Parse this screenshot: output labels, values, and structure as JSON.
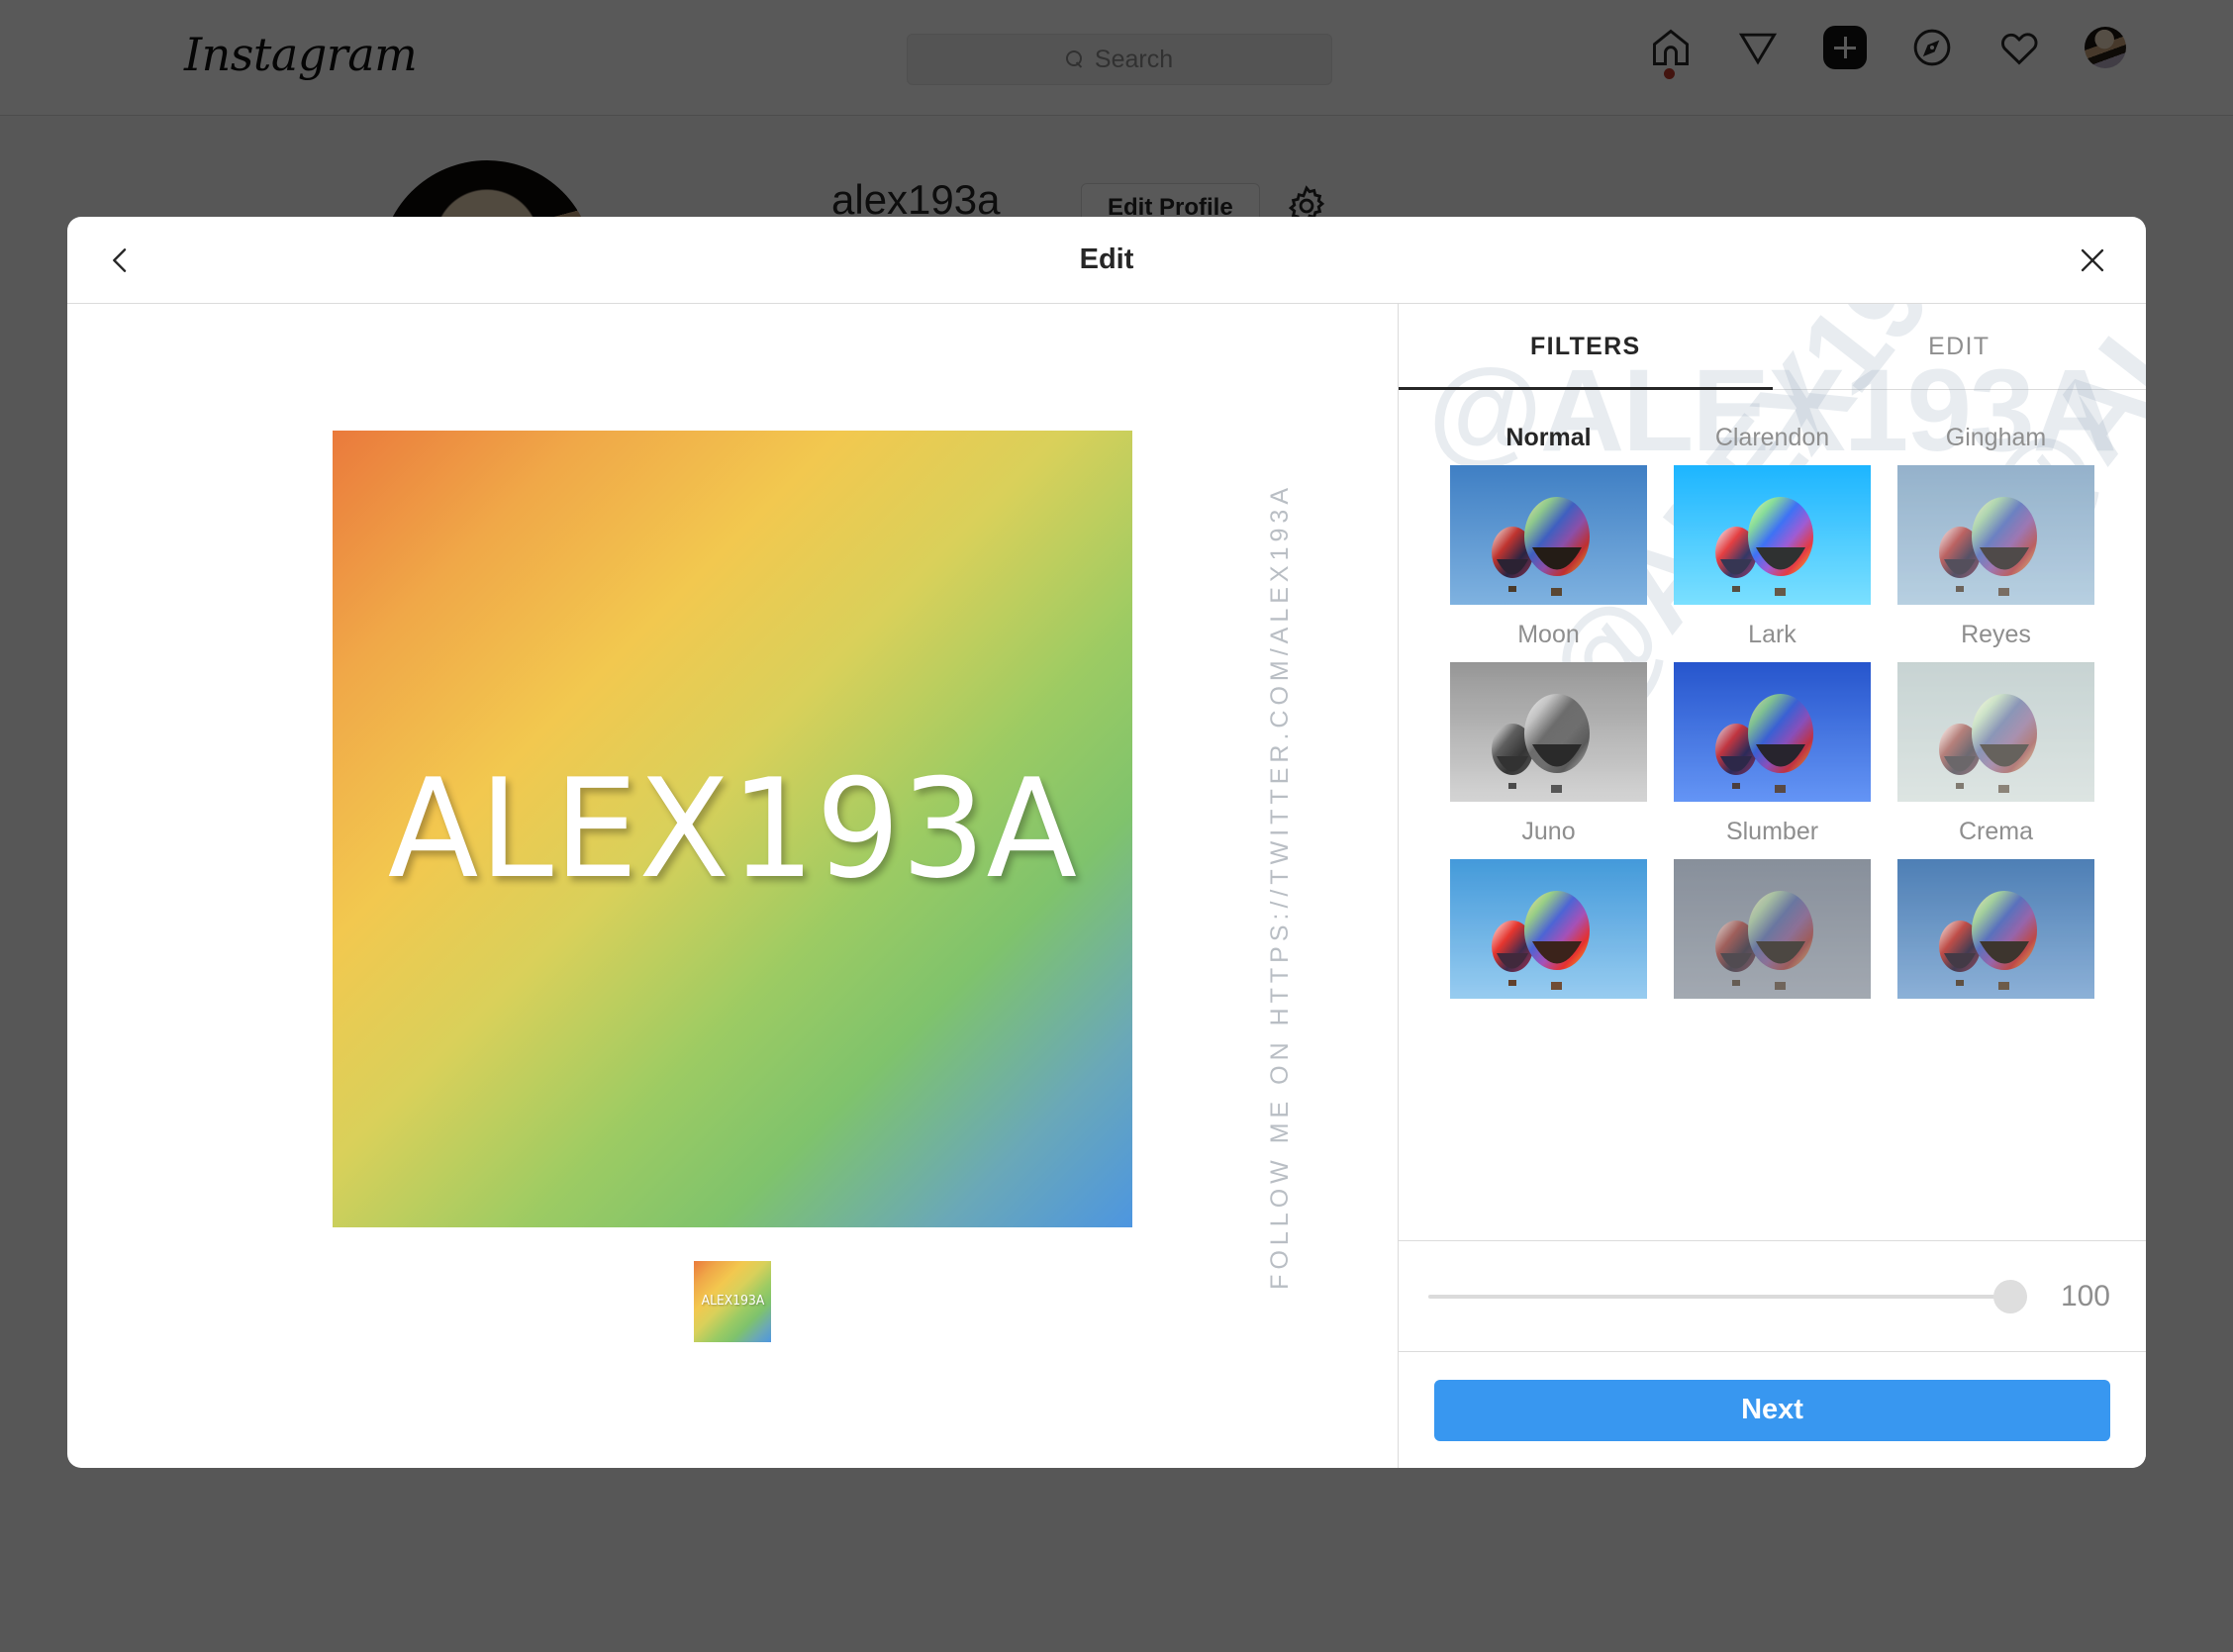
{
  "background": {
    "brand": "Instagram",
    "search": {
      "placeholder": "Search",
      "icon": "search-icon"
    },
    "nav_icons": [
      "home-icon",
      "direct-message-icon",
      "new-post-icon",
      "explore-icon",
      "activity-heart-icon",
      "profile-avatar"
    ],
    "profile": {
      "username": "alex193a",
      "edit_profile_label": "Edit Profile",
      "settings_icon": "gear-icon"
    }
  },
  "modal": {
    "title": "Edit",
    "back_icon": "chevron-left-icon",
    "close_icon": "close-icon",
    "preview": {
      "text": "ALEX193A",
      "thumbnail_text": "ALEX193A"
    },
    "watermark_vertical": "FOLLOW ME ON HTTPS://TWITTER.COM/ALEX193A",
    "watermark_diagonal": "@ALEX193A",
    "tabs": [
      {
        "label": "FILTERS",
        "active": true
      },
      {
        "label": "EDIT",
        "active": false
      }
    ],
    "filters": [
      {
        "label": "Normal",
        "selected": true,
        "sky_top": "#3f7fc4",
        "sky_bottom": "#7fb2e0",
        "sat": 1.0,
        "bright": 1.0,
        "gray": 0.0,
        "tint": "rgba(0,0,0,0)"
      },
      {
        "label": "Clarendon",
        "selected": false,
        "sky_top": "#2f9fe8",
        "sky_bottom": "#86cdf5",
        "sat": 1.3,
        "bright": 1.08,
        "gray": 0.0,
        "tint": "rgba(120,200,255,0.10)"
      },
      {
        "label": "Gingham",
        "selected": false,
        "sky_top": "#6f9cc0",
        "sky_bottom": "#9cc0d8",
        "sat": 0.82,
        "bright": 1.05,
        "gray": 0.05,
        "tint": "rgba(220,225,235,0.22)"
      },
      {
        "label": "Moon",
        "selected": false,
        "sky_top": "#8a8a8a",
        "sky_bottom": "#c8c8c8",
        "sat": 0.0,
        "bright": 1.05,
        "gray": 1.0,
        "tint": "rgba(255,255,255,0.05)"
      },
      {
        "label": "Lark",
        "selected": false,
        "sky_top": "#2a53b8",
        "sky_bottom": "#6f9ae8",
        "sat": 1.15,
        "bright": 1.02,
        "gray": 0.0,
        "tint": "rgba(60,90,200,0.12)"
      },
      {
        "label": "Reyes",
        "selected": false,
        "sky_top": "#8fb1b8",
        "sky_bottom": "#afc6c8",
        "sat": 0.6,
        "bright": 1.12,
        "gray": 0.2,
        "tint": "rgba(230,225,205,0.30)"
      },
      {
        "label": "Juno",
        "selected": false,
        "sky_top": "#3d93cc",
        "sky_bottom": "#8fc8e8",
        "sat": 1.2,
        "bright": 1.05,
        "gray": 0.0,
        "tint": "rgba(255,120,100,0.08)"
      },
      {
        "label": "Slumber",
        "selected": false,
        "sky_top": "#6d82a0",
        "sky_bottom": "#93a6bd",
        "sat": 0.7,
        "bright": 1.0,
        "gray": 0.12,
        "tint": "rgba(190,180,170,0.28)"
      },
      {
        "label": "Crema",
        "selected": false,
        "sky_top": "#2f6fb5",
        "sky_bottom": "#76a6d8",
        "sat": 0.92,
        "bright": 1.03,
        "gray": 0.04,
        "tint": "rgba(235,225,205,0.12)"
      }
    ],
    "slider": {
      "value": "100",
      "min": "0",
      "max": "100"
    },
    "next_label": "Next"
  }
}
